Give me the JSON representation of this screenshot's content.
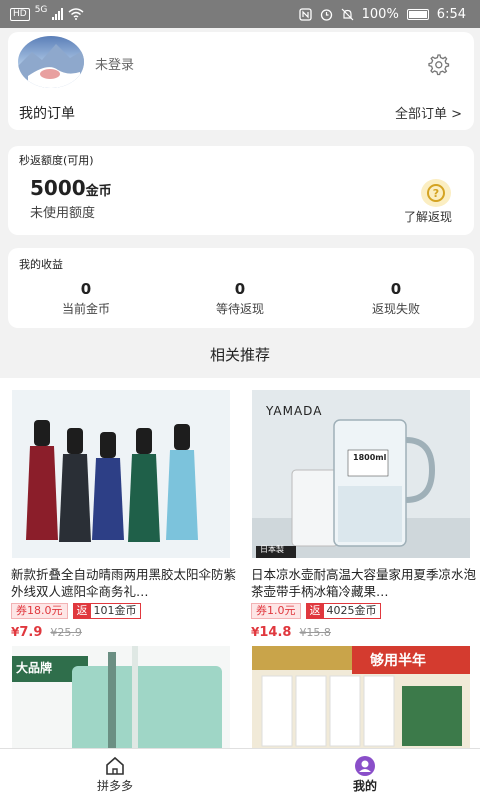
{
  "status_bar": {
    "net_badge": "HD",
    "net_type": "5G",
    "battery_text": "100%",
    "time": "6:54"
  },
  "profile": {
    "login_status": "未登录",
    "orders_label": "我的订单",
    "all_orders": "全部订单 >"
  },
  "quota": {
    "title": "秒返额度(可用)",
    "amount": "5000",
    "unit": "金币",
    "sub": "未使用额度",
    "learn": "了解返现",
    "help_glyph": "?"
  },
  "earnings": {
    "title": "我的收益",
    "stats": [
      {
        "value": "0",
        "label": "当前金币"
      },
      {
        "value": "0",
        "label": "等待返现"
      },
      {
        "value": "0",
        "label": "返现失败"
      }
    ]
  },
  "recommend_title": "相关推荐",
  "products": [
    {
      "title": "新款折叠全自动晴雨两用黑胶太阳伞防紫外线双人遮阳伞商务礼…",
      "coupon": "券18.0元",
      "rebate_label": "返",
      "rebate_value": "101金币",
      "price": "7.9",
      "currency": "¥",
      "orig_price": "¥25.9"
    },
    {
      "title": "日本凉水壶耐高温大容量家用夏季凉水泡茶壶带手柄冰箱冷藏果…",
      "coupon": "券1.0元",
      "rebate_label": "返",
      "rebate_value": "4025金币",
      "price": "14.8",
      "currency": "¥",
      "orig_price": "¥15.8",
      "brand": "YAMADA",
      "pitcher_label": "1800ml",
      "origin": "日本製"
    },
    {
      "brand_tag": "大品牌"
    },
    {
      "banner": "够用半年"
    }
  ],
  "tabbar": {
    "tabs": [
      {
        "label": "拼多多"
      },
      {
        "label": "我的"
      }
    ]
  },
  "colors": {
    "accent": "#e0383e",
    "status_bar": "#7b7b7b",
    "help": "#d4a322"
  }
}
